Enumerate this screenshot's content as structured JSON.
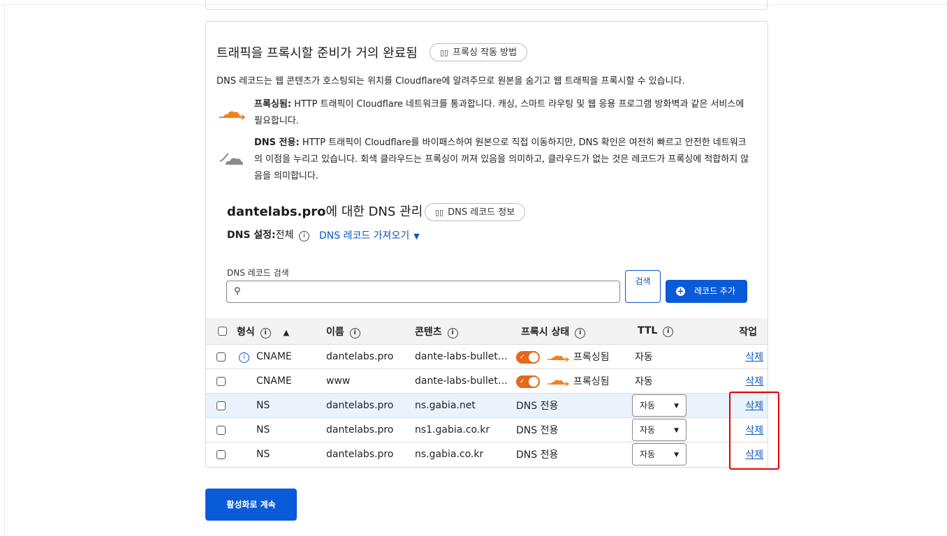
{
  "setup": {
    "title": "트래픽을 프록시할 준비가 거의 완료됨",
    "how_proxy_works": "프록싱 작동 방법",
    "description": "DNS 레코드는 웹 콘텐츠가 호스팅되는 위치를 Cloudflare에 알려주므로 원본을 숨기고 웹 트래픽을 프록시할 수 있습니다.",
    "proxied_label": "프록싱됨:",
    "proxied_text": " HTTP 트래픽이 Cloudflare 네트워크를 통과합니다. 캐싱, 스마트 라우팅 및 웹 응용 프로그램 방화벽과 같은 서비스에 필요합니다.",
    "dns_only_label": "DNS 전용:",
    "dns_only_text": " HTTP 트래픽이 Cloudflare를 바이패스하여 원본으로 직접 이동하지만, DNS 확인은 여전히 빠르고 안전한 네트워크의 이점을 누리고 있습니다. 회색 클라우드는 프록싱이 꺼져 있음을 의미하고, 클라우드가 없는 것은 레코드가 프록싱에 적합하지 않음을 의미합니다."
  },
  "dns": {
    "domain": "dantelabs.pro",
    "title_suffix": "에 대한 DNS 관리",
    "record_info": "DNS 레코드 정보",
    "setting_label": "DNS 설정:",
    "setting_value": "전체",
    "import_label": "DNS 레코드 가져오기",
    "search_label": "DNS 레코드 검색",
    "search_placeholder": "",
    "search_button": "검색",
    "add_record": "레코드 추가",
    "continue_button": "활성화로 계속"
  },
  "table": {
    "headers": {
      "type": "형식",
      "name": "이름",
      "content": "콘텐츠",
      "proxy": "프록시 상태",
      "ttl": "TTL",
      "actions": "작업"
    },
    "rows": [
      {
        "type": "CNAME",
        "name": "dantelabs.pro",
        "content": "dante-labs-bullet…",
        "proxy": "프록싱됨",
        "ttl": "자동",
        "action": "삭제",
        "proxied": true,
        "info": true
      },
      {
        "type": "CNAME",
        "name": "www",
        "content": "dante-labs-bullet…",
        "proxy": "프록싱됨",
        "ttl": "자동",
        "action": "삭제",
        "proxied": true,
        "info": false
      },
      {
        "type": "NS",
        "name": "dantelabs.pro",
        "content": "ns.gabia.net",
        "proxy": "DNS 전용",
        "ttl": "자동",
        "action": "삭제",
        "proxied": false,
        "info": false
      },
      {
        "type": "NS",
        "name": "dantelabs.pro",
        "content": "ns1.gabia.co.kr",
        "proxy": "DNS 전용",
        "ttl": "자동",
        "action": "삭제",
        "proxied": false,
        "info": false
      },
      {
        "type": "NS",
        "name": "dantelabs.pro",
        "content": "ns.gabia.co.kr",
        "proxy": "DNS 전용",
        "ttl": "자동",
        "action": "삭제",
        "proxied": false,
        "info": false
      }
    ]
  },
  "colors": {
    "accent": "#0a5bd8",
    "proxy_orange": "#f38020",
    "highlight": "#e00000",
    "dns_only_grey": "#8a8a8a"
  }
}
